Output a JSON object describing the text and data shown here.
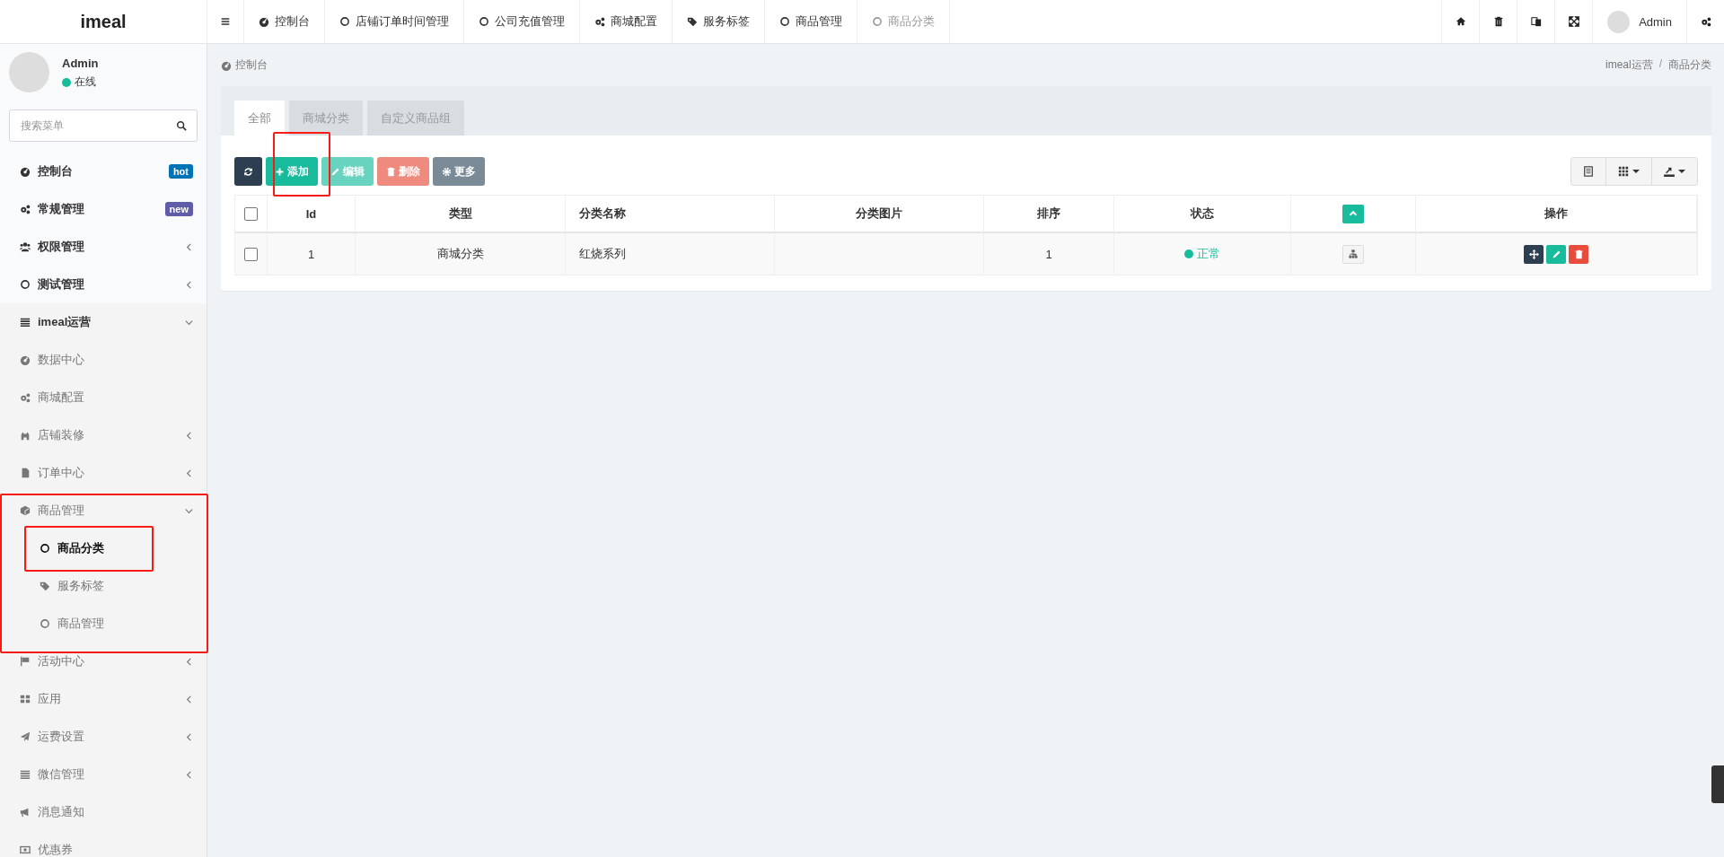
{
  "logo": "imeal",
  "top_nav": {
    "items": [
      {
        "label": "控制台",
        "selected": false
      },
      {
        "label": "店铺订单时间管理",
        "selected": false
      },
      {
        "label": "公司充值管理",
        "selected": false
      },
      {
        "label": "商城配置",
        "selected": false
      },
      {
        "label": "服务标签",
        "selected": false
      },
      {
        "label": "商品管理",
        "selected": false
      },
      {
        "label": "商品分类",
        "selected": true
      }
    ],
    "user": "Admin"
  },
  "user_panel": {
    "name": "Admin",
    "status": "在线",
    "color": "#18bc9c"
  },
  "search": {
    "placeholder": "搜索菜单"
  },
  "sidebar": {
    "items": [
      {
        "label": "控制台",
        "badge": {
          "text": "hot",
          "color": "#0073b7"
        },
        "selected": false
      },
      {
        "label": "常规管理",
        "badge": {
          "text": "new",
          "color": "#605ca8"
        },
        "selected": false
      },
      {
        "label": "权限管理",
        "expanded": false,
        "selected": false
      },
      {
        "label": "测试管理",
        "expanded": false,
        "selected": false
      },
      {
        "label": "imeal运营",
        "expanded": true,
        "selected": false,
        "children": [
          {
            "label": "数据中心",
            "selected": false
          },
          {
            "label": "商城配置",
            "selected": false
          },
          {
            "label": "店铺装修",
            "expanded": false,
            "selected": false
          },
          {
            "label": "订单中心",
            "expanded": false,
            "selected": false
          },
          {
            "label": "商品管理",
            "expanded": true,
            "selected": false,
            "children": [
              {
                "label": "商品分类",
                "selected": true
              },
              {
                "label": "服务标签",
                "selected": false
              },
              {
                "label": "商品管理",
                "selected": false
              }
            ]
          },
          {
            "label": "活动中心",
            "expanded": false,
            "selected": false
          },
          {
            "label": "应用",
            "expanded": false,
            "selected": false
          },
          {
            "label": "运费设置",
            "expanded": false,
            "selected": false
          },
          {
            "label": "微信管理",
            "expanded": false,
            "selected": false
          },
          {
            "label": "消息通知",
            "selected": false
          },
          {
            "label": "优惠券",
            "selected": false
          }
        ]
      }
    ]
  },
  "breadcrumb": {
    "page": "控制台",
    "trail": [
      "imeal运营",
      "商品分类"
    ],
    "separator": "/"
  },
  "tabs": [
    {
      "label": "全部",
      "selected": true
    },
    {
      "label": "商城分类",
      "selected": false
    },
    {
      "label": "自定义商品组",
      "selected": false
    }
  ],
  "toolbar": [
    {
      "kind": "refresh",
      "disabled": false
    },
    {
      "kind": "add",
      "label": "添加",
      "disabled": false
    },
    {
      "kind": "edit",
      "label": "编辑",
      "disabled": true
    },
    {
      "kind": "delete",
      "label": "删除",
      "disabled": true
    },
    {
      "kind": "more",
      "label": "更多",
      "disabled": false
    }
  ],
  "table": {
    "columns": [
      "Id",
      "类型",
      "分类名称",
      "分类图片",
      "排序",
      "状态",
      "",
      "操作"
    ],
    "select_all_checked": false,
    "rows": [
      {
        "checked": false,
        "id": "1",
        "type": "商城分类",
        "name": "红烧系列",
        "sort": "1",
        "status": "正常",
        "color": "#18bc9c"
      }
    ]
  }
}
